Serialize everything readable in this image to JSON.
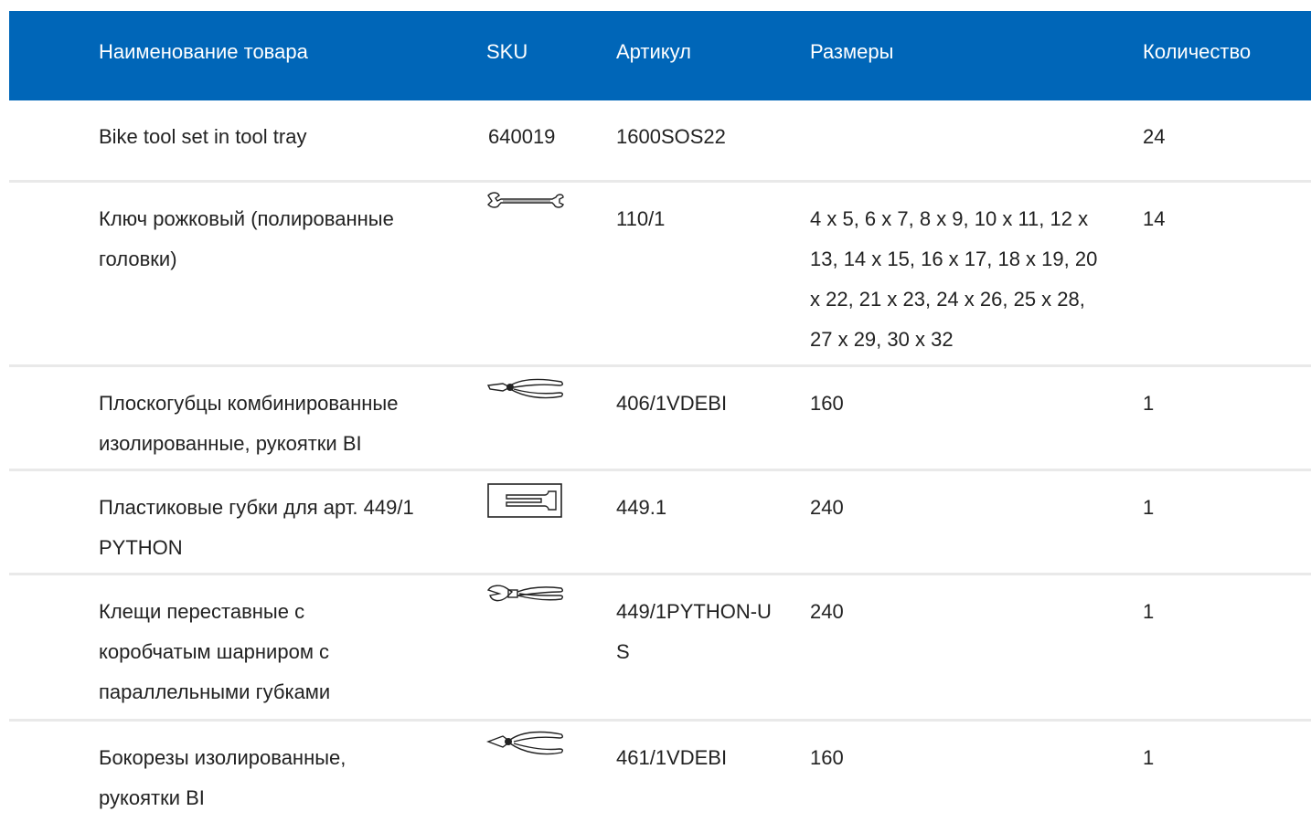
{
  "table": {
    "headers": {
      "name": "Наименование товара",
      "sku": "SKU",
      "article": "Артикул",
      "sizes": "Размеры",
      "quantity": "Количество"
    },
    "rows": [
      {
        "name": "Bike tool set in tool tray",
        "sku": "640019",
        "article": "1600SOS22",
        "sizes": "",
        "quantity": "24"
      },
      {
        "name": "Ключ рожковый (полированные головки)",
        "sku_icon": "open-end-wrench-icon",
        "article": "110/1",
        "sizes": "4 x 5, 6 x 7, 8 x 9, 10 x 11, 12 x 13, 14 x 15, 16 x 17, 18 x 19, 20 x 22, 21 x 23, 24 x 26, 25 x 28, 27 x 29, 30 x 32",
        "quantity": "14"
      },
      {
        "name": "Плоскогубцы комбинированные изолированные, рукоятки BI",
        "sku_icon": "combination-pliers-icon",
        "article": "406/1VDEBI",
        "sizes": "160",
        "quantity": "1"
      },
      {
        "name": "Пластиковые губки для арт. 449/1 PYTHON",
        "sku_icon": "plastic-jaws-icon",
        "article": "449.1",
        "sizes": "240",
        "quantity": "1"
      },
      {
        "name": "Клещи переставные с коробчатым шарниром с параллельными губками",
        "sku_icon": "adjustable-pliers-icon",
        "article": "449/1PYTHON-US",
        "sizes": "240",
        "quantity": "1"
      },
      {
        "name": "Бокорезы изолированные, рукоятки BI",
        "sku_icon": "side-cutters-icon",
        "article": "461/1VDEBI",
        "sizes": "160",
        "quantity": "1"
      }
    ]
  },
  "colors": {
    "header_bg": "#0066b8",
    "header_text": "#ffffff",
    "row_divider": "#e9e9e9",
    "body_text": "#222222"
  }
}
